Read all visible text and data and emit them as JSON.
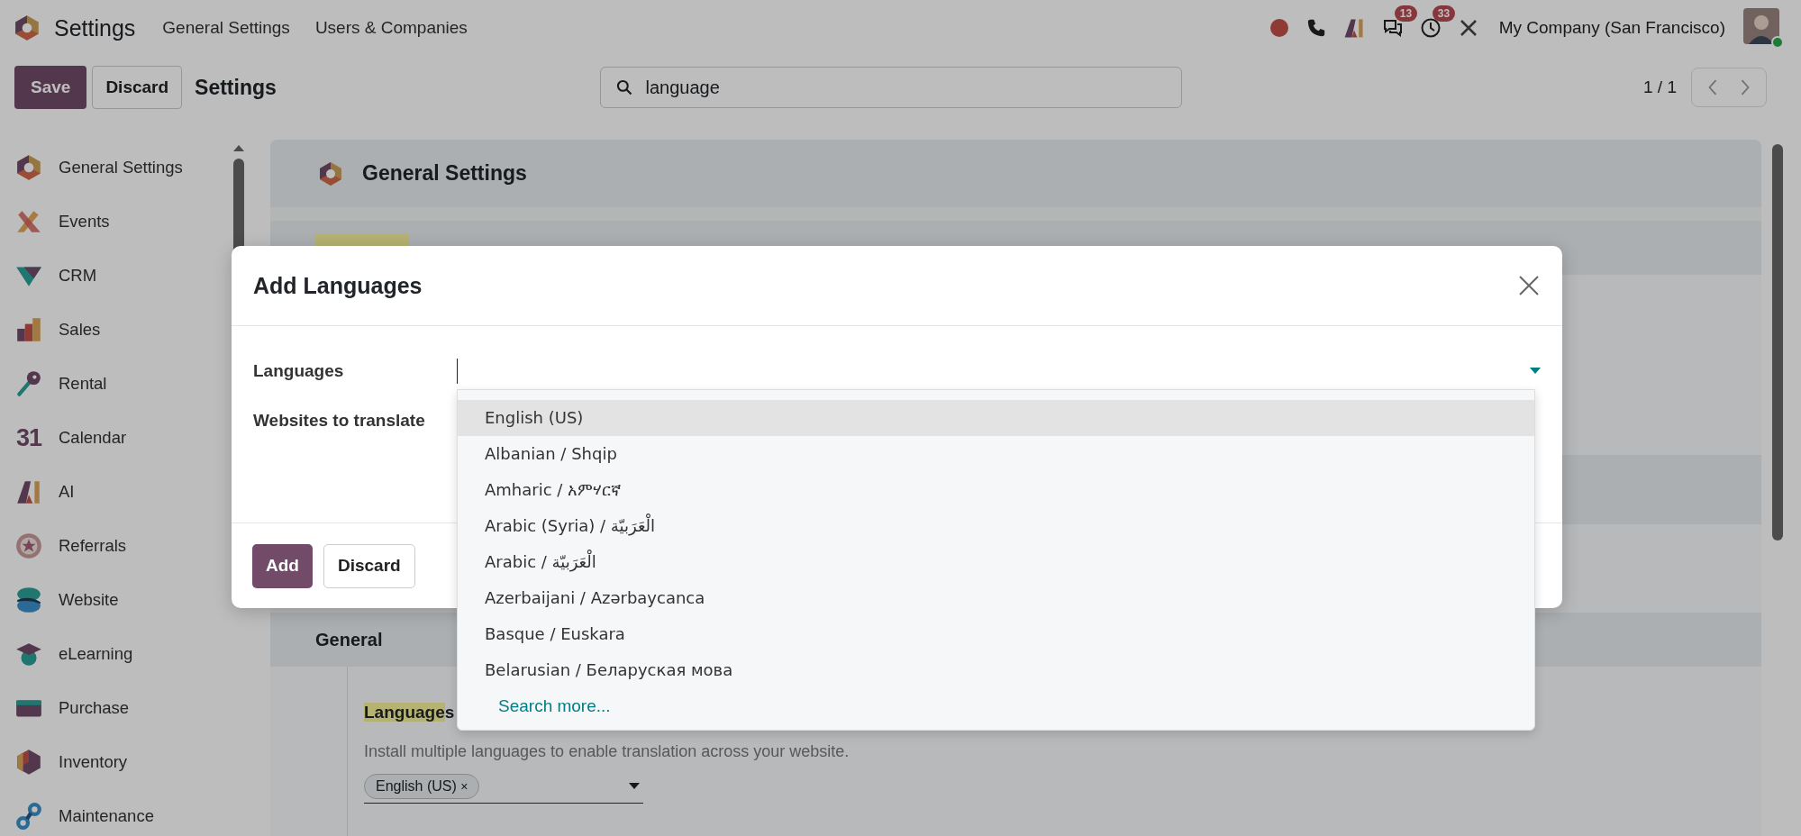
{
  "app": {
    "name": "Settings",
    "menu": [
      "General Settings",
      "Users & Companies"
    ]
  },
  "systray": {
    "messages_badge": "13",
    "activities_badge": "33",
    "company": "My Company (San Francisco)"
  },
  "control_panel": {
    "save": "Save",
    "discard": "Discard",
    "title": "Settings",
    "search": "language",
    "pager": "1 / 1"
  },
  "sidebar": {
    "items": [
      {
        "label": "General Settings"
      },
      {
        "label": "Events"
      },
      {
        "label": "CRM"
      },
      {
        "label": "Sales"
      },
      {
        "label": "Rental"
      },
      {
        "label": "Calendar",
        "icon_text": "31"
      },
      {
        "label": "AI"
      },
      {
        "label": "Referrals"
      },
      {
        "label": "Website"
      },
      {
        "label": "eLearning"
      },
      {
        "label": "Purchase"
      },
      {
        "label": "Inventory"
      },
      {
        "label": "Maintenance"
      }
    ]
  },
  "content": {
    "header": "General Settings",
    "section_title": "General",
    "setting": {
      "title_highlight": "Language",
      "title_rest": "s",
      "description": "Install multiple languages to enable translation across your website.",
      "tags": [
        {
          "label": "English (US)",
          "remove": "×"
        }
      ]
    }
  },
  "modal": {
    "title": "Add Languages",
    "fields": [
      {
        "label": "Languages"
      },
      {
        "label": "Websites to translate"
      }
    ],
    "options": [
      {
        "label": "English (US)",
        "selected": true
      },
      {
        "label": "Albanian / Shqip",
        "selected": false
      },
      {
        "label": "Amharic / አምሃርኛ",
        "selected": false
      },
      {
        "label": "Arabic (Syria) / الْعَرَبيّة",
        "selected": false
      },
      {
        "label": "Arabic / الْعَرَبيّة",
        "selected": false
      },
      {
        "label": "Azerbaijani / Azərbaycanca",
        "selected": false
      },
      {
        "label": "Basque / Euskara",
        "selected": false
      },
      {
        "label": "Belarusian / Беларуская мова",
        "selected": false
      }
    ],
    "search_more": "Search more...",
    "buttons": [
      {
        "label": "Add",
        "kind": "primary"
      },
      {
        "label": "Discard",
        "kind": "secondary"
      }
    ]
  }
}
